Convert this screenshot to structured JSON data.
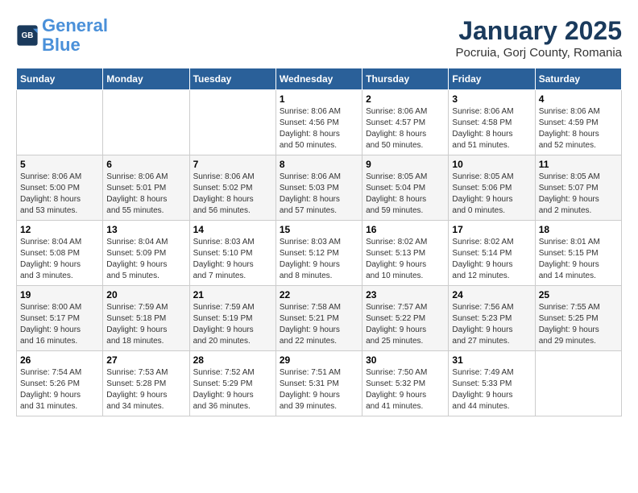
{
  "header": {
    "logo_line1": "General",
    "logo_line2": "Blue",
    "title": "January 2025",
    "subtitle": "Pocruia, Gorj County, Romania"
  },
  "weekdays": [
    "Sunday",
    "Monday",
    "Tuesday",
    "Wednesday",
    "Thursday",
    "Friday",
    "Saturday"
  ],
  "weeks": [
    [
      {
        "day": "",
        "content": ""
      },
      {
        "day": "",
        "content": ""
      },
      {
        "day": "",
        "content": ""
      },
      {
        "day": "1",
        "content": "Sunrise: 8:06 AM\nSunset: 4:56 PM\nDaylight: 8 hours\nand 50 minutes."
      },
      {
        "day": "2",
        "content": "Sunrise: 8:06 AM\nSunset: 4:57 PM\nDaylight: 8 hours\nand 50 minutes."
      },
      {
        "day": "3",
        "content": "Sunrise: 8:06 AM\nSunset: 4:58 PM\nDaylight: 8 hours\nand 51 minutes."
      },
      {
        "day": "4",
        "content": "Sunrise: 8:06 AM\nSunset: 4:59 PM\nDaylight: 8 hours\nand 52 minutes."
      }
    ],
    [
      {
        "day": "5",
        "content": "Sunrise: 8:06 AM\nSunset: 5:00 PM\nDaylight: 8 hours\nand 53 minutes."
      },
      {
        "day": "6",
        "content": "Sunrise: 8:06 AM\nSunset: 5:01 PM\nDaylight: 8 hours\nand 55 minutes."
      },
      {
        "day": "7",
        "content": "Sunrise: 8:06 AM\nSunset: 5:02 PM\nDaylight: 8 hours\nand 56 minutes."
      },
      {
        "day": "8",
        "content": "Sunrise: 8:06 AM\nSunset: 5:03 PM\nDaylight: 8 hours\nand 57 minutes."
      },
      {
        "day": "9",
        "content": "Sunrise: 8:05 AM\nSunset: 5:04 PM\nDaylight: 8 hours\nand 59 minutes."
      },
      {
        "day": "10",
        "content": "Sunrise: 8:05 AM\nSunset: 5:06 PM\nDaylight: 9 hours\nand 0 minutes."
      },
      {
        "day": "11",
        "content": "Sunrise: 8:05 AM\nSunset: 5:07 PM\nDaylight: 9 hours\nand 2 minutes."
      }
    ],
    [
      {
        "day": "12",
        "content": "Sunrise: 8:04 AM\nSunset: 5:08 PM\nDaylight: 9 hours\nand 3 minutes."
      },
      {
        "day": "13",
        "content": "Sunrise: 8:04 AM\nSunset: 5:09 PM\nDaylight: 9 hours\nand 5 minutes."
      },
      {
        "day": "14",
        "content": "Sunrise: 8:03 AM\nSunset: 5:10 PM\nDaylight: 9 hours\nand 7 minutes."
      },
      {
        "day": "15",
        "content": "Sunrise: 8:03 AM\nSunset: 5:12 PM\nDaylight: 9 hours\nand 8 minutes."
      },
      {
        "day": "16",
        "content": "Sunrise: 8:02 AM\nSunset: 5:13 PM\nDaylight: 9 hours\nand 10 minutes."
      },
      {
        "day": "17",
        "content": "Sunrise: 8:02 AM\nSunset: 5:14 PM\nDaylight: 9 hours\nand 12 minutes."
      },
      {
        "day": "18",
        "content": "Sunrise: 8:01 AM\nSunset: 5:15 PM\nDaylight: 9 hours\nand 14 minutes."
      }
    ],
    [
      {
        "day": "19",
        "content": "Sunrise: 8:00 AM\nSunset: 5:17 PM\nDaylight: 9 hours\nand 16 minutes."
      },
      {
        "day": "20",
        "content": "Sunrise: 7:59 AM\nSunset: 5:18 PM\nDaylight: 9 hours\nand 18 minutes."
      },
      {
        "day": "21",
        "content": "Sunrise: 7:59 AM\nSunset: 5:19 PM\nDaylight: 9 hours\nand 20 minutes."
      },
      {
        "day": "22",
        "content": "Sunrise: 7:58 AM\nSunset: 5:21 PM\nDaylight: 9 hours\nand 22 minutes."
      },
      {
        "day": "23",
        "content": "Sunrise: 7:57 AM\nSunset: 5:22 PM\nDaylight: 9 hours\nand 25 minutes."
      },
      {
        "day": "24",
        "content": "Sunrise: 7:56 AM\nSunset: 5:23 PM\nDaylight: 9 hours\nand 27 minutes."
      },
      {
        "day": "25",
        "content": "Sunrise: 7:55 AM\nSunset: 5:25 PM\nDaylight: 9 hours\nand 29 minutes."
      }
    ],
    [
      {
        "day": "26",
        "content": "Sunrise: 7:54 AM\nSunset: 5:26 PM\nDaylight: 9 hours\nand 31 minutes."
      },
      {
        "day": "27",
        "content": "Sunrise: 7:53 AM\nSunset: 5:28 PM\nDaylight: 9 hours\nand 34 minutes."
      },
      {
        "day": "28",
        "content": "Sunrise: 7:52 AM\nSunset: 5:29 PM\nDaylight: 9 hours\nand 36 minutes."
      },
      {
        "day": "29",
        "content": "Sunrise: 7:51 AM\nSunset: 5:31 PM\nDaylight: 9 hours\nand 39 minutes."
      },
      {
        "day": "30",
        "content": "Sunrise: 7:50 AM\nSunset: 5:32 PM\nDaylight: 9 hours\nand 41 minutes."
      },
      {
        "day": "31",
        "content": "Sunrise: 7:49 AM\nSunset: 5:33 PM\nDaylight: 9 hours\nand 44 minutes."
      },
      {
        "day": "",
        "content": ""
      }
    ]
  ]
}
